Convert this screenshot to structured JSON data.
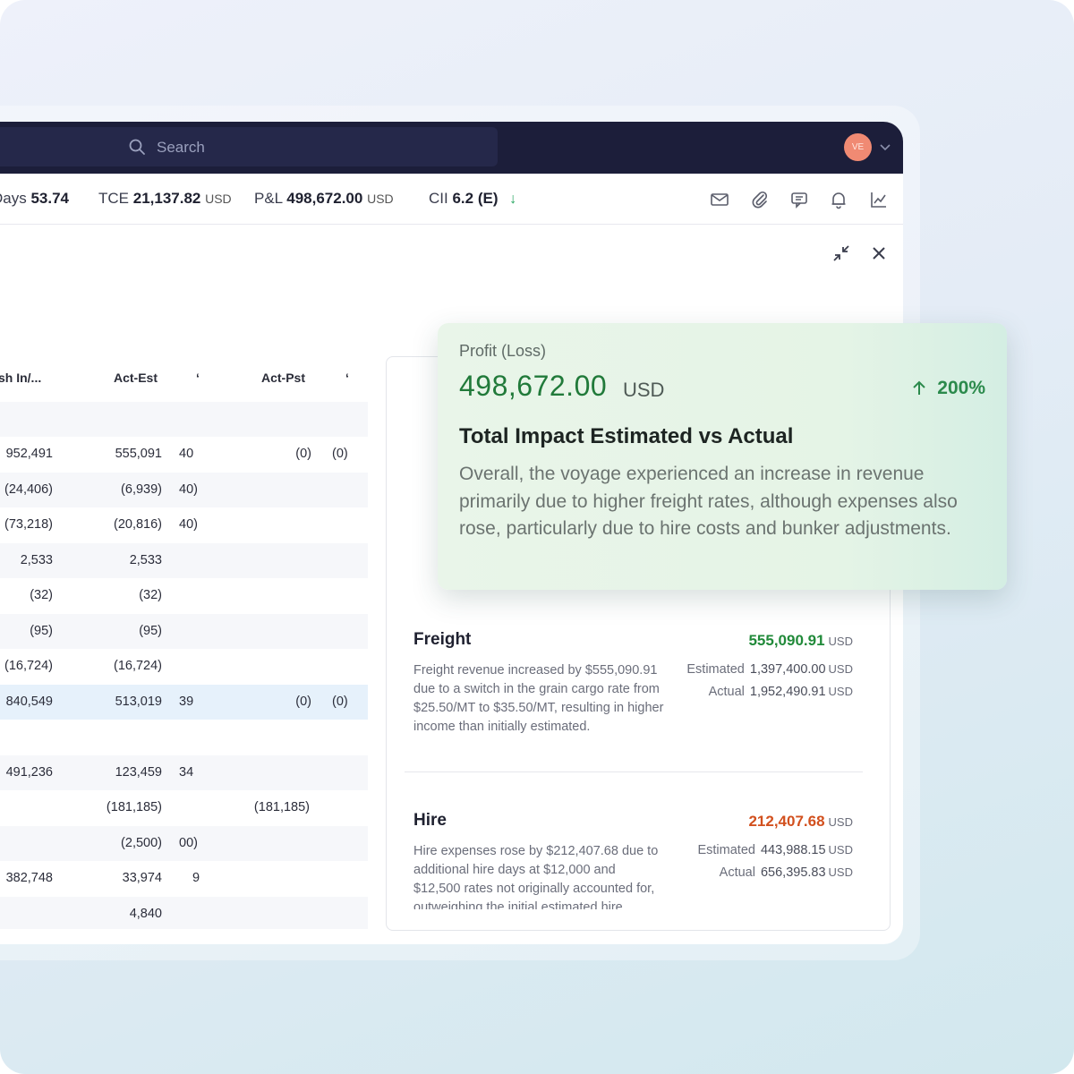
{
  "header": {
    "search_placeholder": "Search",
    "avatar_initials": "VE"
  },
  "metrics": {
    "days_label": "Days",
    "days_value": "53.74",
    "tce_label": "TCE",
    "tce_value": "21,137.82",
    "tce_unit": "USD",
    "pl_label": "P&L",
    "pl_value": "498,672.00",
    "pl_unit": "USD",
    "cii_label": "CII",
    "cii_value": "6.2 (E)"
  },
  "toolbar_icons": [
    "mail-icon",
    "attachment-icon",
    "chat-icon",
    "bell-icon",
    "chart-icon"
  ],
  "table": {
    "headers": [
      "sh In/...",
      "Act-Est",
      "ʻ",
      "Act-Pst",
      "ʻ"
    ],
    "rows": [
      {
        "c1": "",
        "c2": "",
        "c3": "",
        "c4": "",
        "c5": ""
      },
      {
        "c1": "952,491",
        "c2": "555,091",
        "c3": "40",
        "c4": "(0)",
        "c5": "(0)"
      },
      {
        "c1": "(24,406)",
        "c2": "(6,939)",
        "c3": "40)",
        "c4": "",
        "c5": ""
      },
      {
        "c1": "(73,218)",
        "c2": "(20,816)",
        "c3": "40)",
        "c4": "",
        "c5": ""
      },
      {
        "c1": "2,533",
        "c2": "2,533",
        "c3": "",
        "c4": "",
        "c5": ""
      },
      {
        "c1": "(32)",
        "c2": "(32)",
        "c3": "",
        "c4": "",
        "c5": ""
      },
      {
        "c1": "(95)",
        "c2": "(95)",
        "c3": "",
        "c4": "",
        "c5": ""
      },
      {
        "c1": "(16,724)",
        "c2": "(16,724)",
        "c3": "",
        "c4": "",
        "c5": ""
      },
      {
        "c1": "840,549",
        "c2": "513,019",
        "c3": "39",
        "c4": "(0)",
        "c5": "(0)"
      },
      {
        "c1": "",
        "c2": "",
        "c3": "",
        "c4": "",
        "c5": ""
      },
      {
        "c1": "491,236",
        "c2": "123,459",
        "c3": "34",
        "c4": "",
        "c5": ""
      },
      {
        "c1": "",
        "c2": "(181,185)",
        "c3": "",
        "c4": "(181,185)",
        "c5": ""
      },
      {
        "c1": "",
        "c2": "(2,500)",
        "c3": "00)",
        "c4": "",
        "c5": ""
      },
      {
        "c1": "382,748",
        "c2": "33,974",
        "c3": "9",
        "c4": "",
        "c5": ""
      },
      {
        "c1": "",
        "c2": "4,840",
        "c3": "",
        "c4": "",
        "c5": ""
      }
    ]
  },
  "overlay": {
    "label": "Profit (Loss)",
    "amount": "498,672.00",
    "unit": "USD",
    "change": "200%",
    "title": "Total Impact Estimated vs Actual",
    "body": "Overall, the voyage experienced an increase in revenue primarily due to higher freight rates, although expenses also rose, particularly due to hire costs and bunker adjustments.",
    "colors": {
      "amount": "#217a3a",
      "change": "#2b8a4c"
    }
  },
  "sections": [
    {
      "title": "Freight",
      "total": "555,090.91",
      "unit": "USD",
      "total_color": "#218a3a",
      "description": "Freight revenue increased by $555,090.91 due to a switch in the grain cargo rate from $25.50/MT to $35.50/MT, resulting in higher income than initially estimated.",
      "estimated_label": "Estimated",
      "estimated_value": "1,397,400.00",
      "actual_label": "Actual",
      "actual_value": "1,952,490.91"
    },
    {
      "title": "Hire",
      "total": "212,407.68",
      "unit": "USD",
      "total_color": "#d2501e",
      "description": "Hire expenses rose by $212,407.68 due to additional hire days at $12,000 and $12,500 rates not originally accounted for, outweighing the initial estimated hire",
      "estimated_label": "Estimated",
      "estimated_value": "443,988.15",
      "actual_label": "Actual",
      "actual_value": "656,395.83"
    }
  ]
}
